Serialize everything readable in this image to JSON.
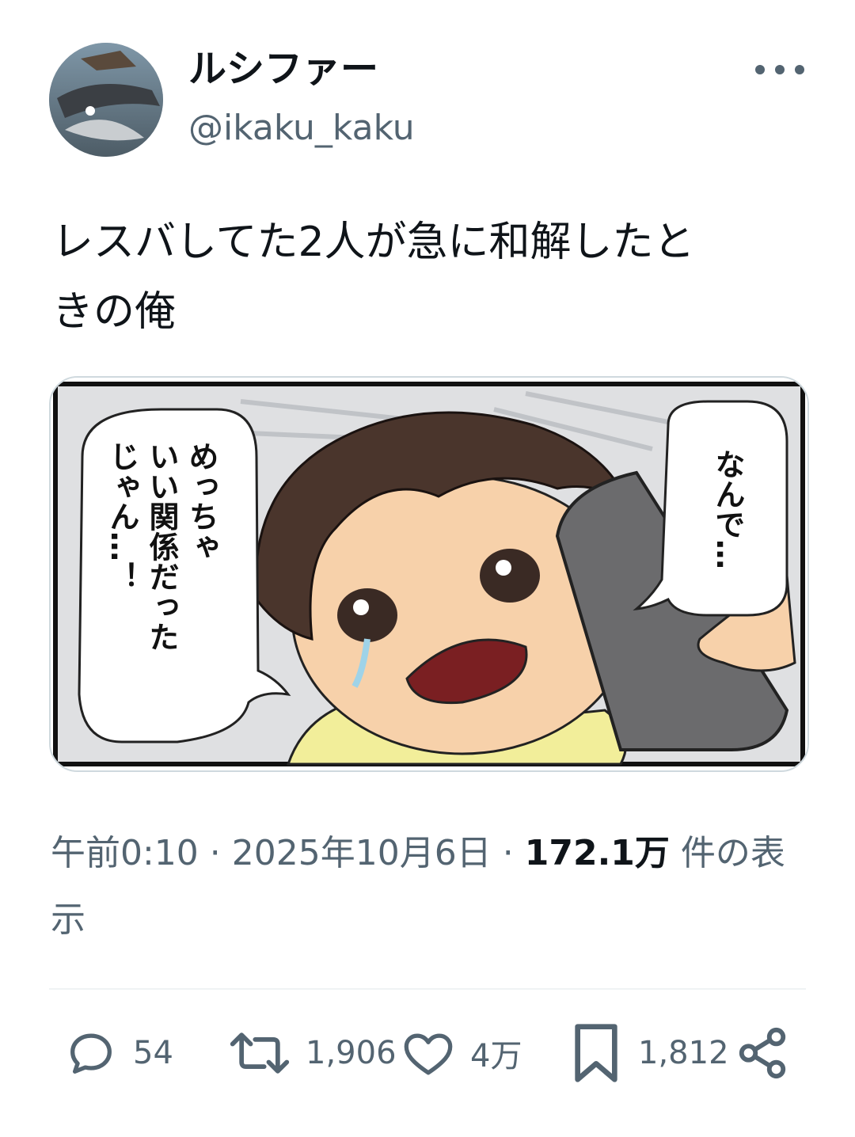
{
  "author": {
    "display_name": "ルシファー",
    "handle": "@ikaku_kaku"
  },
  "tweet": {
    "text": "レスバしてた2人が急に和解したと\nきの俺"
  },
  "media": {
    "balloon_right": "なんで…",
    "balloon_left_lines": [
      "めっちゃ",
      "いい関係だった",
      "じゃん…！"
    ]
  },
  "meta": {
    "time": "午前0:10",
    "separator": " · ",
    "date": "2025年10月6日",
    "views_count": "172.1万",
    "views_suffix": " 件の表示"
  },
  "actions": {
    "replies": "54",
    "reposts": "1,906",
    "likes": "4万",
    "bookmarks": "1,812"
  },
  "icons": [
    "reply-icon",
    "repost-icon",
    "like-icon",
    "bookmark-icon",
    "share-icon",
    "more-icon"
  ]
}
